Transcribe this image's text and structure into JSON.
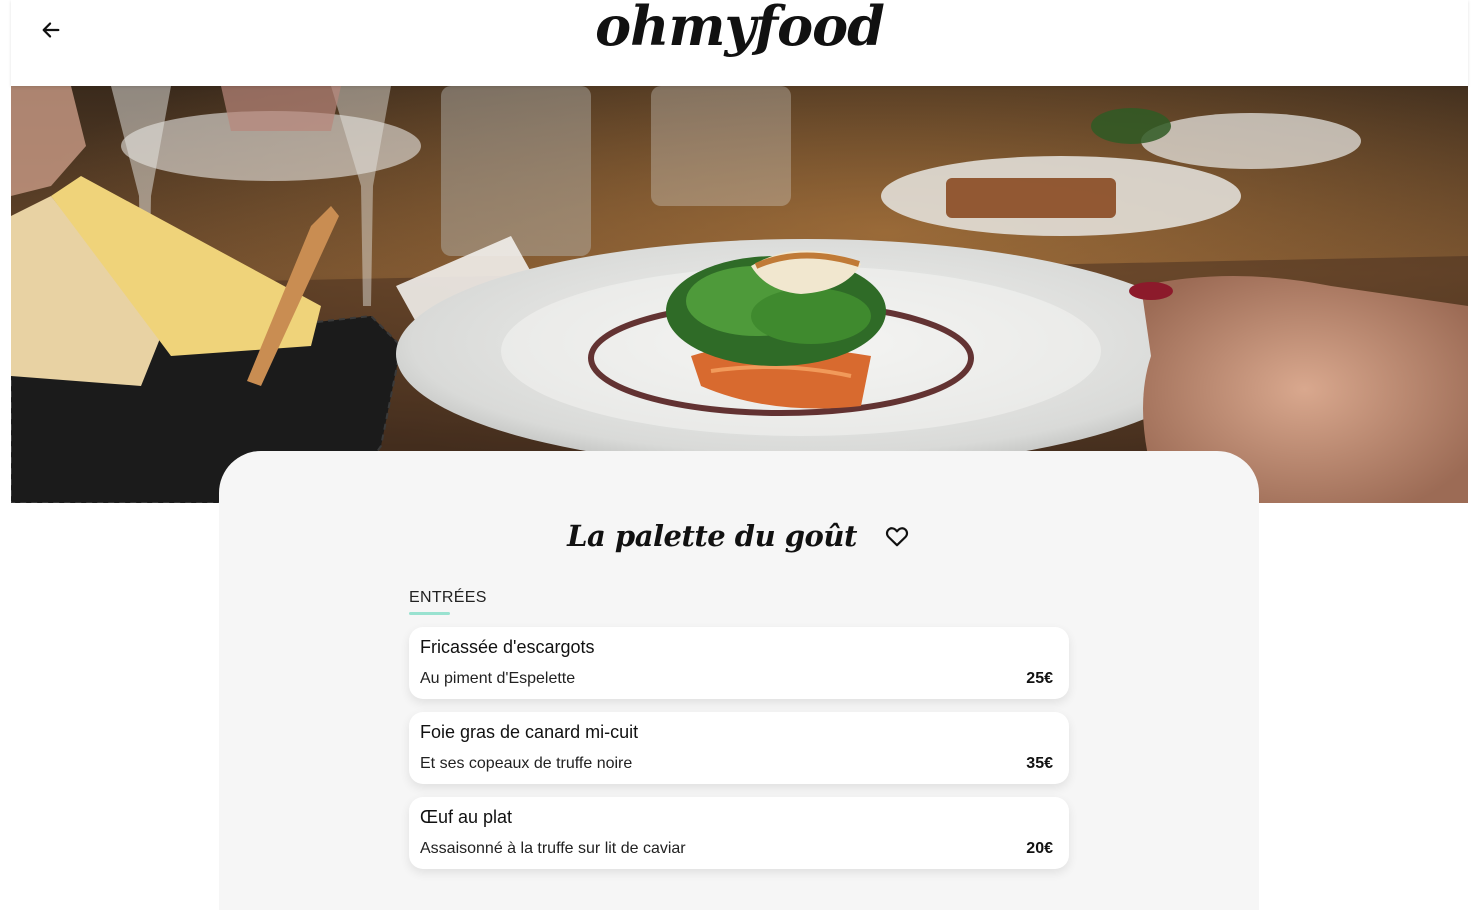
{
  "header": {
    "logo": "ohmyfood",
    "back_icon": "arrow-left-icon"
  },
  "hero": {
    "image": "restaurant-plated-dish-photo"
  },
  "restaurant": {
    "name": "La palette du goût",
    "favorite_icon": "heart-outline-icon"
  },
  "menu": {
    "section_title": "ENTRÉES",
    "accent_color": "#99e2d0",
    "items": [
      {
        "name": "Fricassée d'escargots",
        "description": "Au piment d'Espelette",
        "price": "25€"
      },
      {
        "name": "Foie gras de canard mi-cuit",
        "description": "Et ses copeaux de truffe noire",
        "price": "35€"
      },
      {
        "name": "Œuf au plat",
        "description": "Assaisonné à la truffe sur lit de caviar",
        "price": "20€"
      }
    ]
  },
  "colors": {
    "card_background": "#f6f6f6",
    "item_background": "#ffffff",
    "text": "#111111"
  }
}
